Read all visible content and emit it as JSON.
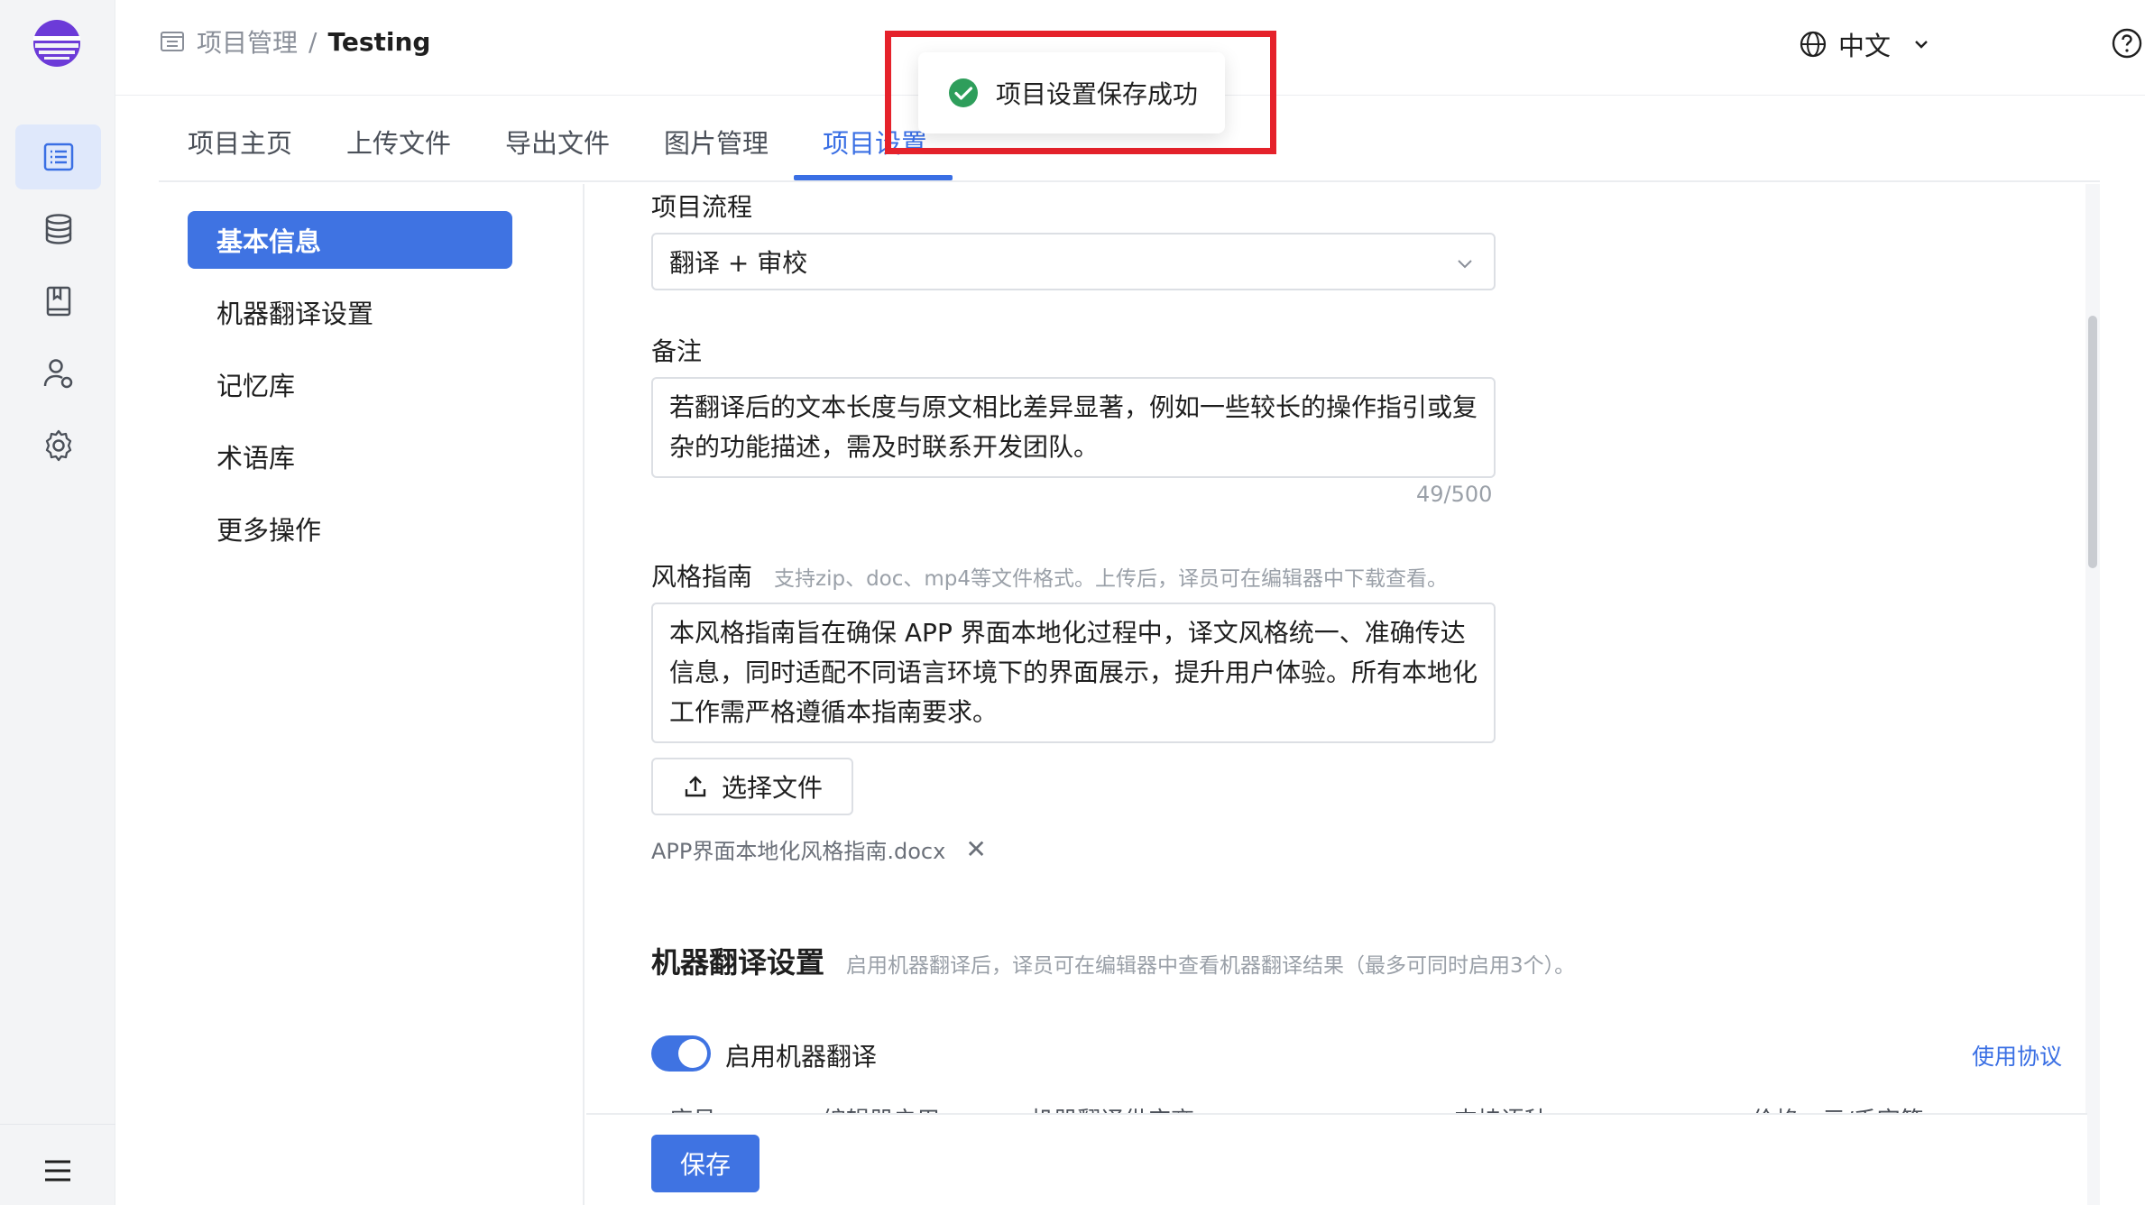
{
  "breadcrumb": {
    "root": "项目管理",
    "separator": "/",
    "current": "Testing"
  },
  "header": {
    "language": "中文"
  },
  "tabs": [
    {
      "label": "项目主页"
    },
    {
      "label": "上传文件"
    },
    {
      "label": "导出文件"
    },
    {
      "label": "图片管理"
    },
    {
      "label": "项目设置"
    }
  ],
  "active_tab": "项目设置",
  "side_menu": [
    {
      "label": "基本信息"
    },
    {
      "label": "机器翻译设置"
    },
    {
      "label": "记忆库"
    },
    {
      "label": "术语库"
    },
    {
      "label": "更多操作"
    }
  ],
  "form": {
    "workflow_label": "项目流程",
    "workflow_value": "翻译 + 审校",
    "notes_label": "备注",
    "notes_value": "若翻译后的文本长度与原文相比差异显著，例如一些较长的操作指引或复杂的功能描述，需及时联系开发团队。",
    "notes_counter": "49/500",
    "style_label": "风格指南",
    "style_hint": "支持zip、doc、mp4等文件格式。上传后，译员可在编辑器中下载查看。",
    "style_value": "本风格指南旨在确保 APP 界面本地化过程中，译文风格统一、准确传达信息，同时适配不同语言环境下的界面展示，提升用户体验。所有本地化工作需严格遵循本指南要求。",
    "upload_label": "选择文件",
    "file_name": "APP界面本地化风格指南.docx",
    "file_remove": "✕"
  },
  "mt_section": {
    "title": "机器翻译设置",
    "hint": "启用机器翻译后，译员可在编辑器中查看机器翻译结果（最多可同时启用3个）。",
    "toggle_label": "启用机器翻译",
    "toggle_on": true,
    "agreement_link": "使用协议",
    "columns": [
      "序号",
      "编辑器启用",
      "机器翻译供应商",
      "支持语种",
      "价格：元/千字符"
    ]
  },
  "footer": {
    "save_label": "保存"
  },
  "toast": {
    "message": "项目设置保存成功"
  },
  "colors": {
    "accent": "#3f73e2",
    "highlight": "#e5222b",
    "success": "#2e9e5b"
  }
}
